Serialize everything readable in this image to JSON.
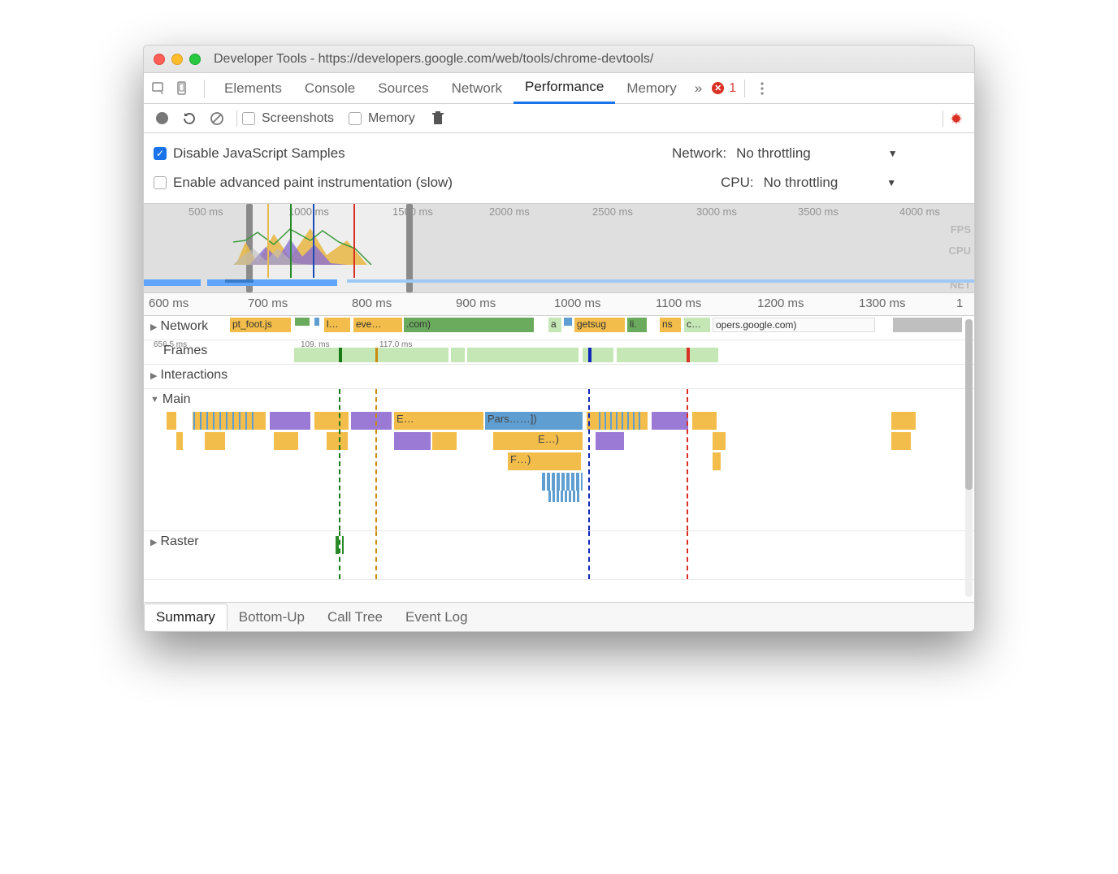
{
  "window_title": "Developer Tools - https://developers.google.com/web/tools/chrome-devtools/",
  "tabs": {
    "elements": "Elements",
    "console": "Console",
    "sources": "Sources",
    "network": "Network",
    "performance": "Performance",
    "memory": "Memory",
    "more": "»",
    "error_count": "1"
  },
  "toolbar": {
    "screenshots": "Screenshots",
    "memory": "Memory"
  },
  "settings": {
    "disable_samples": "Disable JavaScript Samples",
    "enable_paint": "Enable advanced paint instrumentation (slow)",
    "network_label": "Network:",
    "network_value": "No throttling",
    "cpu_label": "CPU:",
    "cpu_value": "No throttling"
  },
  "overview": {
    "ticks": [
      "500 ms",
      "1000 ms",
      "1500 ms",
      "2000 ms",
      "2500 ms",
      "3000 ms",
      "3500 ms",
      "4000 ms"
    ],
    "lanes": {
      "fps": "FPS",
      "cpu": "CPU",
      "net": "NET"
    }
  },
  "ruler_ticks": [
    "600 ms",
    "700 ms",
    "800 ms",
    "900 ms",
    "1000 ms",
    "1100 ms",
    "1200 ms",
    "1300 ms"
  ],
  "tracks": {
    "network": "Network",
    "frames": "Frames",
    "interactions": "Interactions",
    "main": "Main",
    "raster": "Raster"
  },
  "network_items": {
    "a": "pt_foot.js",
    "b": "l…",
    "c": "eve…",
    "d": ".com)",
    "e": "a",
    "f": "getsug",
    "g": "li.",
    "h": "ns",
    "i": "c…",
    "j": "opers.google.com)"
  },
  "frame_times": {
    "a": "656.5 ms",
    "b": "109. ms",
    "c": "117.0 ms"
  },
  "flame": {
    "e": "E…",
    "pars": "Pars……])",
    "e2": "E…)",
    "f": "F…)"
  },
  "bottom_tabs": {
    "summary": "Summary",
    "bottomup": "Bottom-Up",
    "calltree": "Call Tree",
    "eventlog": "Event Log"
  }
}
